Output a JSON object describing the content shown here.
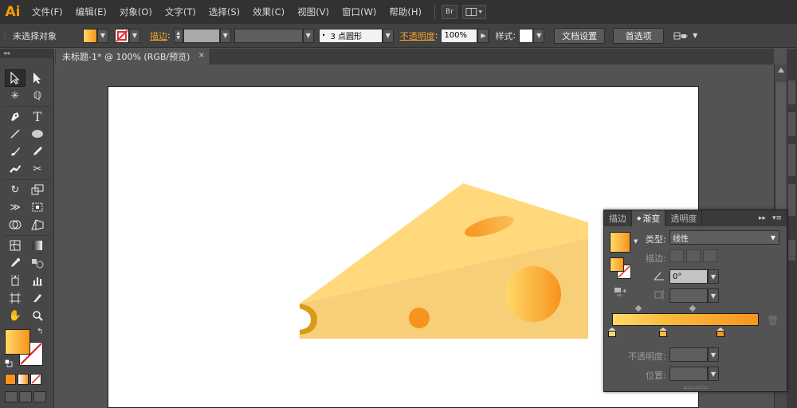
{
  "app": {
    "logo": "Ai"
  },
  "menu": {
    "items": [
      "文件(F)",
      "编辑(E)",
      "对象(O)",
      "文字(T)",
      "选择(S)",
      "效果(C)",
      "视图(V)",
      "窗口(W)",
      "帮助(H)"
    ],
    "bridge_label": "Br"
  },
  "controlbar": {
    "selection_status": "未选择对象",
    "stroke_label": "描边",
    "brush_value": "3 点圆形",
    "opacity_label": "不透明度",
    "opacity_value": "100%",
    "style_label": "样式",
    "doc_setup_button": "文档设置",
    "preferences_button": "首选项"
  },
  "document": {
    "tab_title": "未标题-1* @ 100% (RGB/预览)",
    "close_glyph": "×"
  },
  "colors": {
    "cheese_light": "#fcd57a",
    "cheese_top": "#ffd97c",
    "cheese_front": "#f7d07a",
    "hole_orange": "#f7931e",
    "accent_orange": "#f0a030"
  },
  "tools": {
    "icons": [
      "selection-tool-icon",
      "direct-selection-tool-icon",
      "magic-wand-tool-icon",
      "lasso-tool-icon",
      "pen-tool-icon",
      "type-tool-icon",
      "line-tool-icon",
      "ellipse-tool-icon",
      "paintbrush-tool-icon",
      "pencil-tool-icon",
      "blob-brush-tool-icon",
      "scissors-tool-icon",
      "rotate-tool-icon",
      "scale-tool-icon",
      "width-tool-icon",
      "free-transform-tool-icon",
      "shape-builder-tool-icon",
      "perspective-grid-tool-icon",
      "mesh-tool-icon",
      "gradient-tool-icon",
      "eyedropper-tool-icon",
      "blend-tool-icon",
      "symbol-sprayer-tool-icon",
      "column-graph-tool-icon",
      "artboard-tool-icon",
      "slice-tool-icon",
      "hand-tool-icon",
      "zoom-tool-icon"
    ]
  },
  "gradient_panel": {
    "tabs": [
      "描边",
      "渐变",
      "透明度"
    ],
    "type_label": "类型:",
    "type_value": "线性",
    "stroke_label": "描边:",
    "angle_value": "0°",
    "opacity_label": "不透明度:",
    "location_label": "位置:",
    "stops": [
      {
        "position": 0,
        "color": "#ffd96a"
      },
      {
        "position": 0.35,
        "color": "#fcbc40"
      },
      {
        "position": 0.74,
        "color": "#f8941c"
      }
    ]
  }
}
